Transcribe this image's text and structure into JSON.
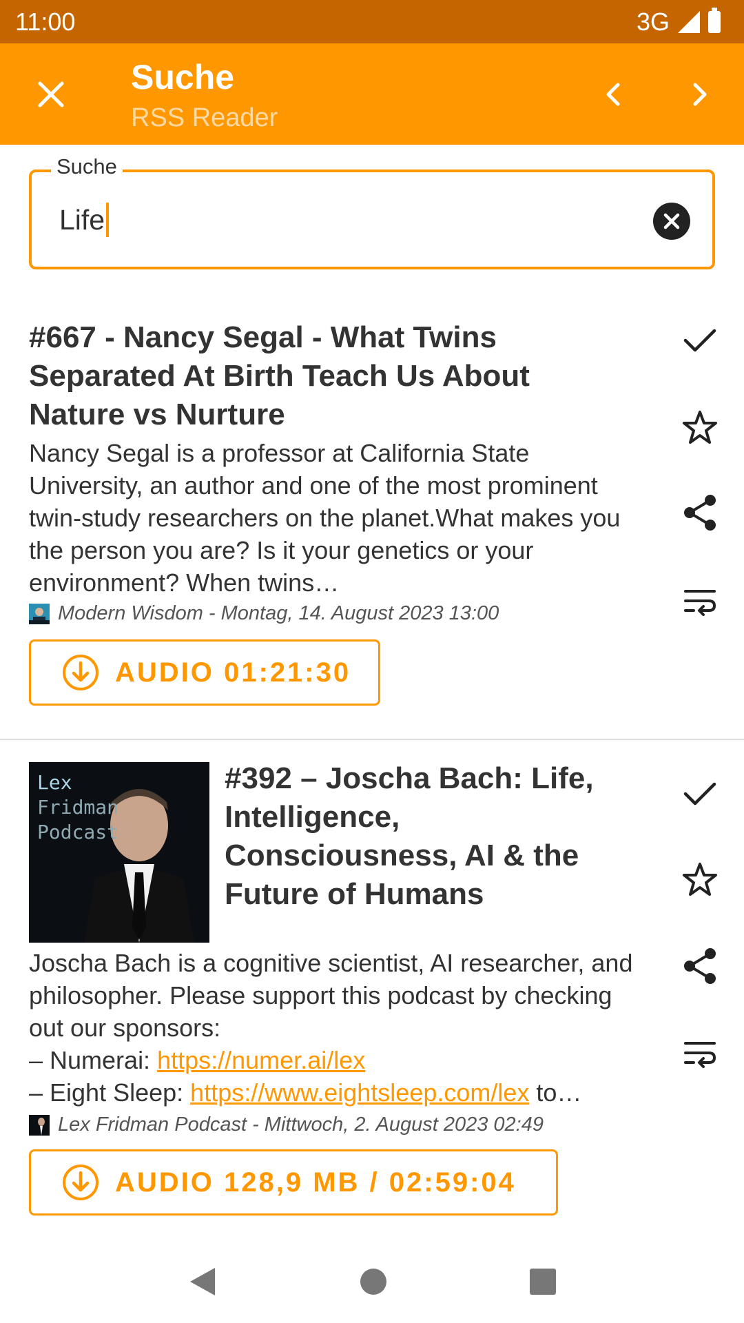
{
  "status_bar": {
    "time": "11:00",
    "network": "3G"
  },
  "app_bar": {
    "title": "Suche",
    "subtitle": "RSS Reader"
  },
  "search": {
    "label": "Suche",
    "value": "Life"
  },
  "articles": [
    {
      "title": "#667 - Nancy Segal - What Twins Separated At Birth Teach Us About Nature vs Nurture",
      "description": "Nancy Segal is a professor at California State University, an author and one of the most prominent twin-study researchers on the planet.What makes you the person you are? Is it your genetics or your environment? When twins…",
      "meta": "Modern Wisdom - Montag, 14. August 2023 13:00",
      "audio_label": "AUDIO 01:21:30"
    },
    {
      "title": "#392 – Joscha Bach: Life, Intelligence, Consciousness, AI & the Future of Humans",
      "description_lines": {
        "intro": "Joscha Bach is a cognitive scientist, AI researcher, and philosopher. Please support this podcast by checking out our sponsors:",
        "sponsor1_prefix": "– Numerai: ",
        "sponsor1_link": "https://numer.ai/lex",
        "sponsor2_prefix": "– Eight Sleep: ",
        "sponsor2_link": "https://www.eightsleep.com/lex",
        "sponsor2_suffix": " to…"
      },
      "cover_text": [
        "Lex",
        "Fridman",
        "Podcast"
      ],
      "meta": "Lex Fridman Podcast - Mittwoch, 2. August 2023 02:49",
      "audio_label": "AUDIO 128,9 MB / 02:59:04"
    }
  ],
  "colors": {
    "accent": "#ff9800",
    "status_bar": "#c46500",
    "text": "#333333"
  }
}
